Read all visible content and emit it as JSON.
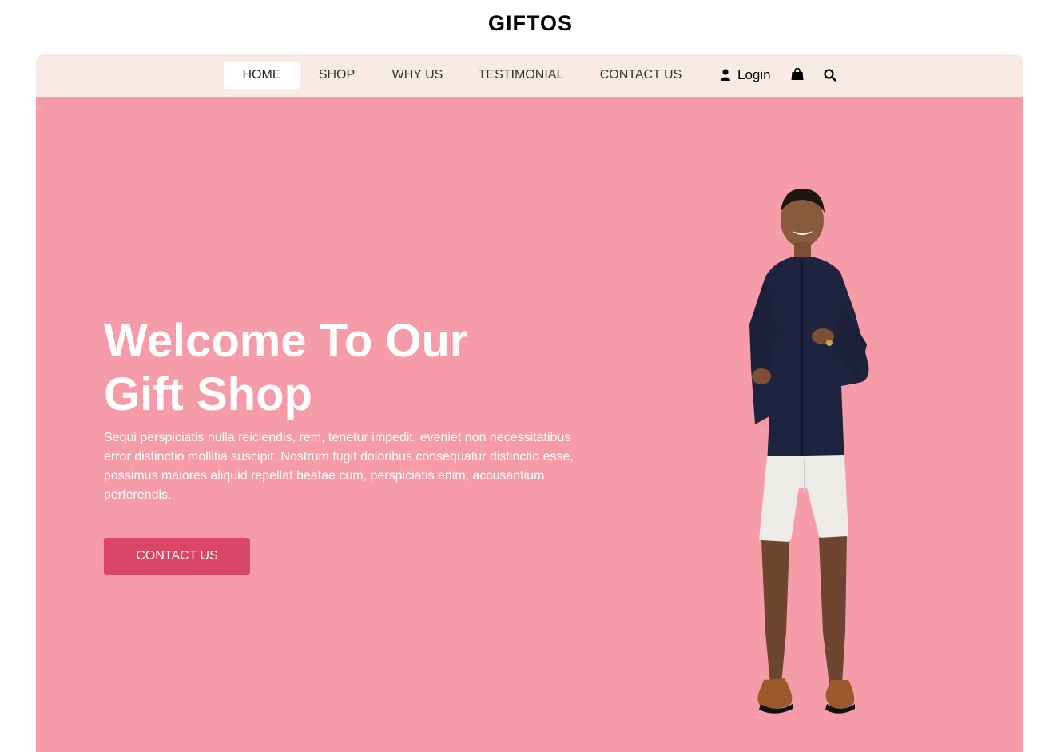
{
  "brand": {
    "name": "GIFTOS"
  },
  "nav": {
    "items": [
      {
        "label": "HOME",
        "active": true
      },
      {
        "label": "SHOP"
      },
      {
        "label": "WHY US"
      },
      {
        "label": "TESTIMONIAL"
      },
      {
        "label": "CONTACT US"
      }
    ],
    "login_label": "Login",
    "icons": [
      "user-icon",
      "shopping-bag-icon",
      "search-icon"
    ]
  },
  "hero": {
    "title_line1": "Welcome To Our",
    "title_line2": "Gift Shop",
    "text": "Sequi perspiciatis nulla reiciendis, rem, tenetur impedit, eveniet non necessitatibus error distinctio mollitia suscipit. Nostrum fugit doloribus consequatur distinctio esse, possimus maiores aliquid repellat beatae cum, perspiciatis enim, accusantium perferendis.",
    "button_label": "CONTACT US"
  },
  "colors": {
    "nav_bg": "#f8ebe6",
    "hero_bg": "#f69ca9",
    "accent": "#db4566",
    "text_light": "#ffffff"
  }
}
